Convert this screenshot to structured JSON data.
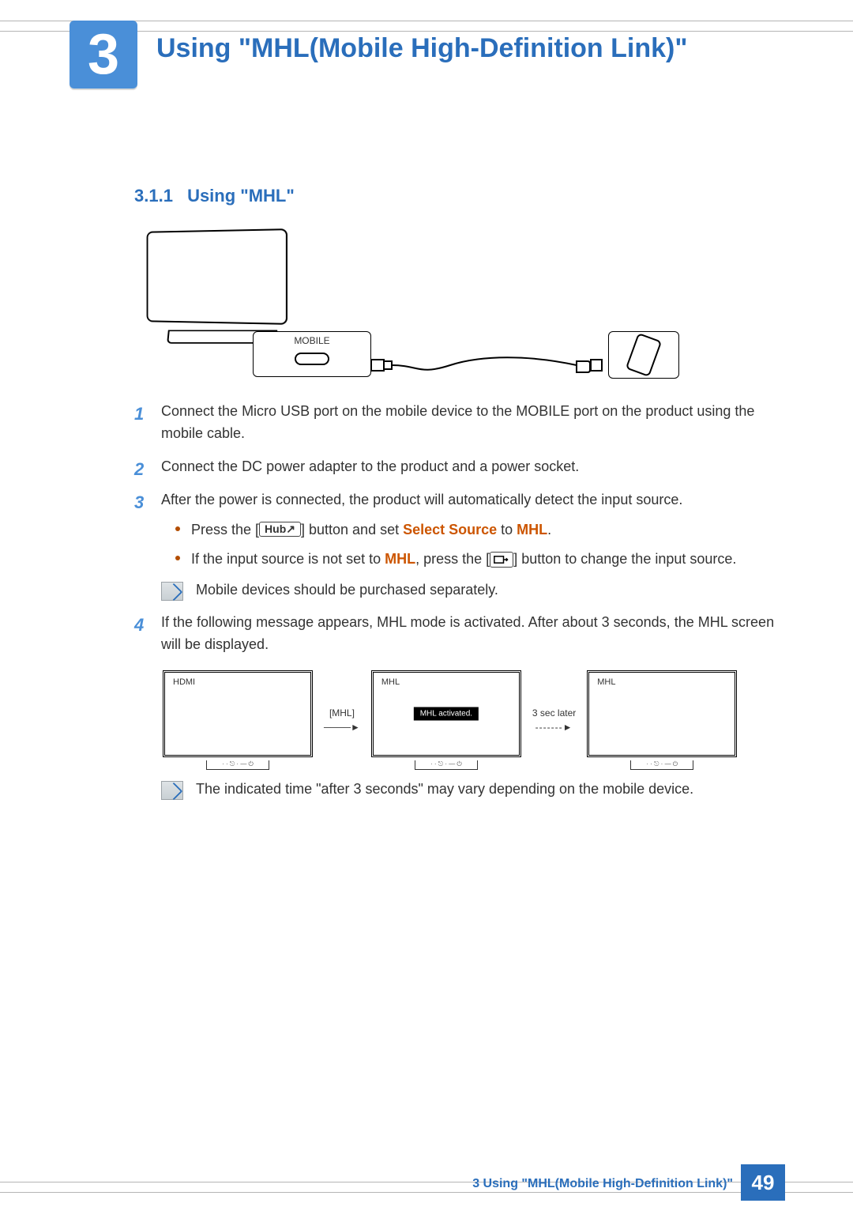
{
  "chapter": {
    "number": "3",
    "title": "Using \"MHL(Mobile High-Definition Link)\""
  },
  "section": {
    "number": "3.1.1",
    "title": "Using \"MHL\""
  },
  "diagram": {
    "port_label": "MOBILE"
  },
  "steps": [
    {
      "num": "1",
      "text": "Connect the Micro USB port on the mobile device to the MOBILE port on the product using the mobile cable."
    },
    {
      "num": "2",
      "text": "Connect the DC power adapter to the product and a power socket."
    },
    {
      "num": "3",
      "text": "After the power is connected, the product will automatically detect the input source.",
      "sub": [
        {
          "pre": "Press the [",
          "btn": "Hub",
          "mid": "] button and set ",
          "kw1": "Select Source",
          "mid2": " to ",
          "kw2": "MHL",
          "post": "."
        },
        {
          "pre": "If the input source is not set to ",
          "kw1": "MHL",
          "mid": ", press the [",
          "icon": "source",
          "mid2": "] button to change the input source.",
          "kw2": "",
          "post": ""
        }
      ],
      "note": "Mobile devices should be purchased separately."
    },
    {
      "num": "4",
      "text": "If the following message appears, MHL mode is activated. After about 3 seconds, the MHL screen will be displayed."
    }
  ],
  "screens": {
    "s1_label": "HDMI",
    "arrow1_label": "[MHL]",
    "s2_label": "MHL",
    "s2_message": "MHL activated.",
    "arrow2_label": "3 sec later",
    "s3_label": "MHL"
  },
  "screens_note": "The indicated time \"after 3 seconds\" may vary depending on the mobile device.",
  "footer": {
    "text": "3 Using \"MHL(Mobile High-Definition Link)\"",
    "page": "49"
  }
}
